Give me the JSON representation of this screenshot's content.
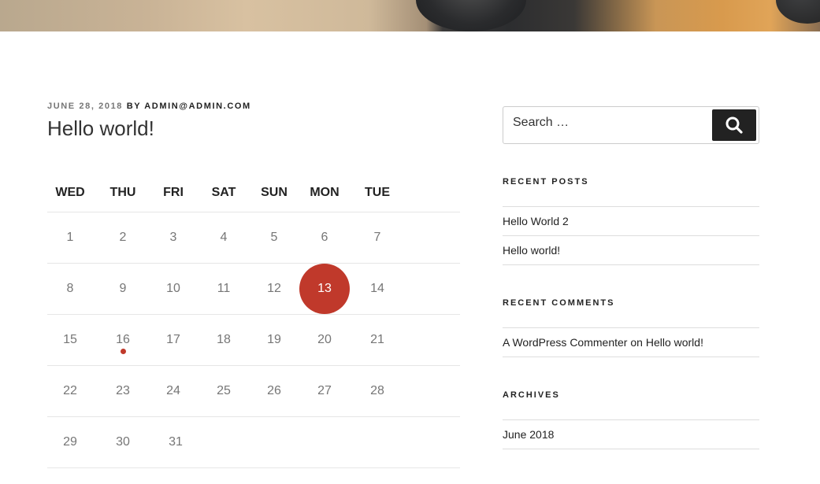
{
  "post": {
    "date": "JUNE 28, 2018",
    "by": "BY",
    "author": "ADMIN@ADMIN.COM",
    "title": "Hello world!"
  },
  "calendar": {
    "weekdays": [
      "WED",
      "THU",
      "FRI",
      "SAT",
      "SUN",
      "MON",
      "TUE"
    ],
    "weeks": [
      [
        "1",
        "2",
        "3",
        "4",
        "5",
        "6",
        "7"
      ],
      [
        "8",
        "9",
        "10",
        "11",
        "12",
        "13",
        "14"
      ],
      [
        "15",
        "16",
        "17",
        "18",
        "19",
        "20",
        "21"
      ],
      [
        "22",
        "23",
        "24",
        "25",
        "26",
        "27",
        "28"
      ],
      [
        "29",
        "30",
        "31"
      ]
    ],
    "selected_day": "13",
    "event_day": "16",
    "accent_color": "#c0392b"
  },
  "sidebar": {
    "search": {
      "placeholder": "Search …",
      "button_icon": "search-icon"
    },
    "recent_posts": {
      "title": "RECENT POSTS",
      "items": [
        "Hello World 2",
        "Hello world!"
      ]
    },
    "recent_comments": {
      "title": "RECENT COMMENTS",
      "author": "A WordPress Commenter",
      "on": "on",
      "post": "Hello world!"
    },
    "archives": {
      "title": "ARCHIVES",
      "items": [
        "June 2018"
      ]
    }
  }
}
